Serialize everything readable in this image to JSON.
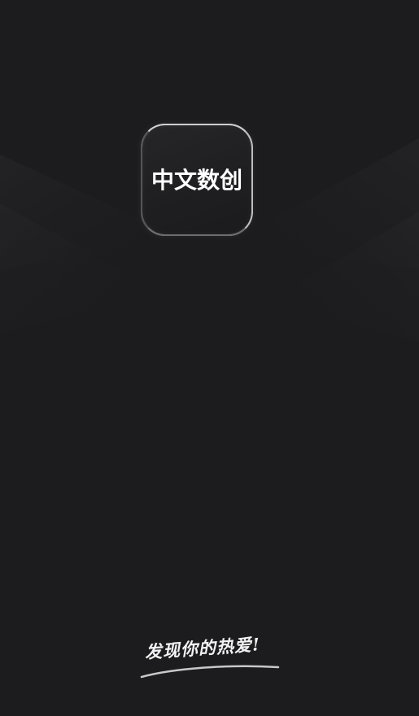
{
  "app_icon": {
    "title": "中文数创"
  },
  "slogan": {
    "text": "发现你的热爱!"
  },
  "colors": {
    "background": "#1c1c1e",
    "icon_border": "#bdbdbd",
    "text": "#ffffff"
  }
}
